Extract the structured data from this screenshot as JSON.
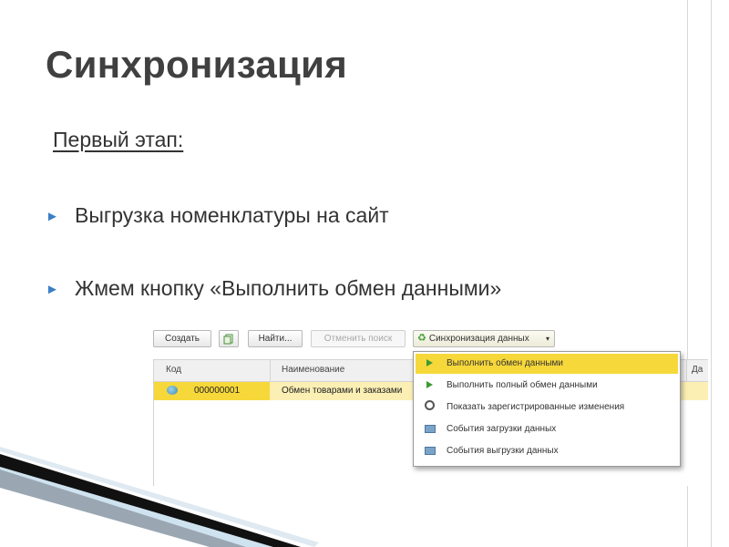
{
  "slide": {
    "title": "Синхронизация",
    "subtitle": "Первый этап:",
    "bullets": [
      "Выгрузка номенклатуры на сайт",
      "Жмем кнопку «Выполнить обмен данными»"
    ],
    "bullet_marker": "►"
  },
  "toolbar": {
    "create_label": "Создать",
    "find_label": "Найти...",
    "cancel_search_label": "Отменить поиск",
    "sync_label": "Синхронизация данных",
    "sync_caret": "▾"
  },
  "table": {
    "columns": [
      "Код",
      "Наименование",
      "Да"
    ],
    "rows": [
      {
        "code": "000000001",
        "name": "Обмен товарами и заказами"
      }
    ]
  },
  "sync_menu": {
    "items": [
      {
        "label": "Выполнить обмен данными",
        "icon": "play-icon",
        "highlighted": true
      },
      {
        "label": "Выполнить полный обмен данными",
        "icon": "play-icon",
        "highlighted": false
      },
      {
        "label": "Показать зарегистрированные изменения",
        "icon": "magnifier-icon",
        "highlighted": false
      },
      {
        "label": "События загрузки данных",
        "icon": "journal-icon",
        "highlighted": false
      },
      {
        "label": "События выгрузки данных",
        "icon": "journal-icon",
        "highlighted": false
      }
    ]
  },
  "colors": {
    "title": "#404040",
    "bullet_marker": "#3b7ec4",
    "highlight": "#f7d83a",
    "row_highlight": "#fbefb4"
  }
}
